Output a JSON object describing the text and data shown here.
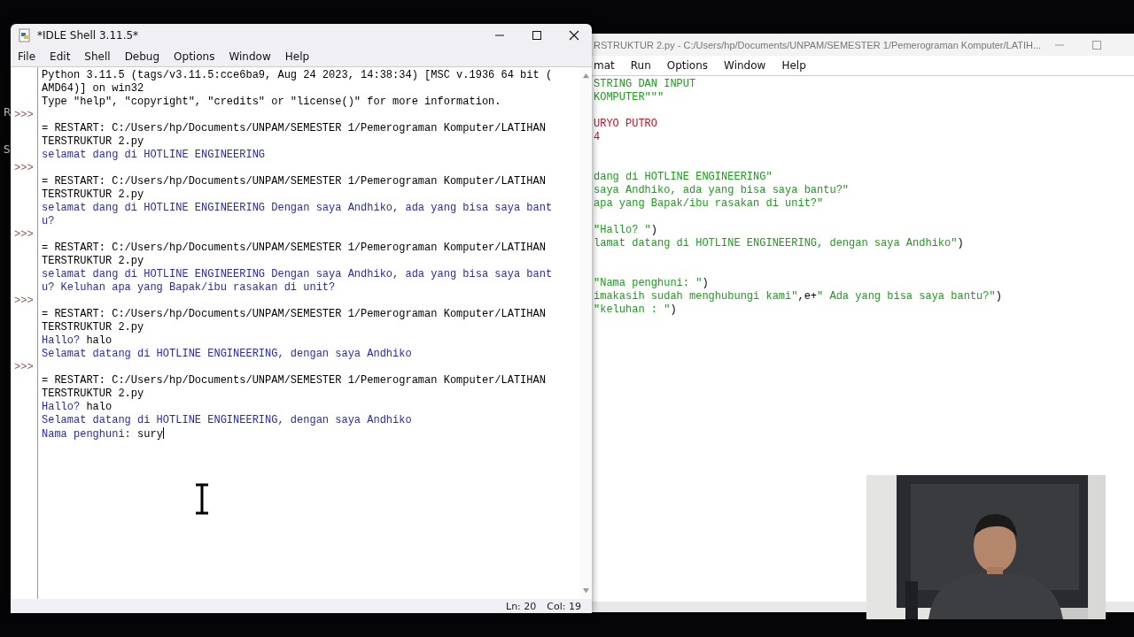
{
  "desktop_fragments": [
    "R",
    "S"
  ],
  "editor_window": {
    "title": "RSTRUKTUR 2.py - C:/Users/hp/Documents/UNPAM/SEMESTER 1/Pemerograman Komputer/LATIH...",
    "menu": [
      "mat",
      "Run",
      "Options",
      "Window",
      "Help"
    ],
    "lines": [
      [
        {
          "text": "STRING DAN INPUT",
          "kind": "string"
        }
      ],
      [
        {
          "text": "KOMPUTER\"\"\"",
          "kind": "string"
        }
      ],
      [
        {
          "kind": "blank"
        }
      ],
      [
        {
          "text": "URYO PUTRO",
          "kind": "comment"
        }
      ],
      [
        {
          "text": "4",
          "kind": "comment"
        }
      ],
      [
        {
          "kind": "blank"
        }
      ],
      [
        {
          "kind": "blank"
        }
      ],
      [
        {
          "text": "dang di HOTLINE ENGINEERING\"",
          "kind": "string"
        }
      ],
      [
        {
          "text": "saya Andhiko, ada yang bisa saya bantu?\"",
          "kind": "string"
        }
      ],
      [
        {
          "text": "apa yang Bapak/ibu rasakan di unit?\"",
          "kind": "string"
        }
      ],
      [
        {
          "kind": "blank"
        }
      ],
      [
        {
          "text": "\"Hallo? \"",
          "kind": "string"
        },
        {
          "text": ")",
          "kind": "plain"
        }
      ],
      [
        {
          "text": "lamat datang di HOTLINE ENGINEERING, dengan saya Andhiko\"",
          "kind": "string"
        },
        {
          "text": ")",
          "kind": "plain"
        }
      ],
      [
        {
          "kind": "blank"
        }
      ],
      [
        {
          "kind": "blank"
        }
      ],
      [
        {
          "text": "\"Nama penghuni: \"",
          "kind": "string"
        },
        {
          "text": ")",
          "kind": "plain"
        }
      ],
      [
        {
          "text": "imakasih sudah menghubungi kami\"",
          "kind": "string"
        },
        {
          "text": ",e+",
          "kind": "plain"
        },
        {
          "text": "\" Ada yang bisa saya bantu?\"",
          "kind": "string"
        },
        {
          "text": ")",
          "kind": "plain"
        }
      ],
      [
        {
          "text": "\"keluhan : \"",
          "kind": "string"
        },
        {
          "text": ")",
          "kind": "plain"
        }
      ]
    ]
  },
  "shell_window": {
    "title": "*IDLE Shell 3.11.5*",
    "menu": [
      "File",
      "Edit",
      "Shell",
      "Debug",
      "Options",
      "Window",
      "Help"
    ],
    "lines": [
      {
        "kind": "output",
        "text": "Python 3.11.5 (tags/v3.11.5:cce6ba9, Aug 24 2023, 14:38:34) [MSC v.1936 64 bit ("
      },
      {
        "kind": "output",
        "text": "AMD64)] on win32"
      },
      {
        "kind": "output",
        "text": "Type \"help\", \"copyright\", \"credits\" or \"license()\" for more information."
      },
      {
        "kind": "prompt",
        "prompt": ">>>"
      },
      {
        "kind": "output",
        "text": "= RESTART: C:/Users/hp/Documents/UNPAM/SEMESTER 1/Pemerograman Komputer/LATIHAN"
      },
      {
        "kind": "output",
        "text": "TERSTRUKTUR 2.py"
      },
      {
        "kind": "stdout",
        "text": "selamat dang di HOTLINE ENGINEERING"
      },
      {
        "kind": "prompt",
        "prompt": ">>>"
      },
      {
        "kind": "output",
        "text": "= RESTART: C:/Users/hp/Documents/UNPAM/SEMESTER 1/Pemerograman Komputer/LATIHAN"
      },
      {
        "kind": "output",
        "text": "TERSTRUKTUR 2.py"
      },
      {
        "kind": "stdout",
        "text": "selamat dang di HOTLINE ENGINEERING Dengan saya Andhiko, ada yang bisa saya bant"
      },
      {
        "kind": "stdout",
        "text": "u?"
      },
      {
        "kind": "prompt",
        "prompt": ">>>"
      },
      {
        "kind": "output",
        "text": "= RESTART: C:/Users/hp/Documents/UNPAM/SEMESTER 1/Pemerograman Komputer/LATIHAN"
      },
      {
        "kind": "output",
        "text": "TERSTRUKTUR 2.py"
      },
      {
        "kind": "stdout",
        "text": "selamat dang di HOTLINE ENGINEERING Dengan saya Andhiko, ada yang bisa saya bant"
      },
      {
        "kind": "stdout",
        "text": "u? Keluhan apa yang Bapak/ibu rasakan di unit?"
      },
      {
        "kind": "prompt",
        "prompt": ">>>"
      },
      {
        "kind": "output",
        "text": "= RESTART: C:/Users/hp/Documents/UNPAM/SEMESTER 1/Pemerograman Komputer/LATIHAN"
      },
      {
        "kind": "output",
        "text": "TERSTRUKTUR 2.py"
      },
      {
        "kind": "stdout",
        "text": "Hallo? ",
        "input": "halo"
      },
      {
        "kind": "stdout",
        "text": "Selamat datang di HOTLINE ENGINEERING, dengan saya Andhiko"
      },
      {
        "kind": "prompt",
        "prompt": ">>>"
      },
      {
        "kind": "output",
        "text": "= RESTART: C:/Users/hp/Documents/UNPAM/SEMESTER 1/Pemerograman Komputer/LATIHAN"
      },
      {
        "kind": "output",
        "text": "TERSTRUKTUR 2.py"
      },
      {
        "kind": "stdout",
        "text": "Hallo? ",
        "input": "halo"
      },
      {
        "kind": "stdout",
        "text": "Selamat datang di HOTLINE ENGINEERING, dengan saya Andhiko"
      },
      {
        "kind": "stdout",
        "text": "Nama penghuni: ",
        "input": "sury",
        "cursor": true
      }
    ],
    "status": [
      "Ln: 20",
      "Col: 19"
    ]
  }
}
